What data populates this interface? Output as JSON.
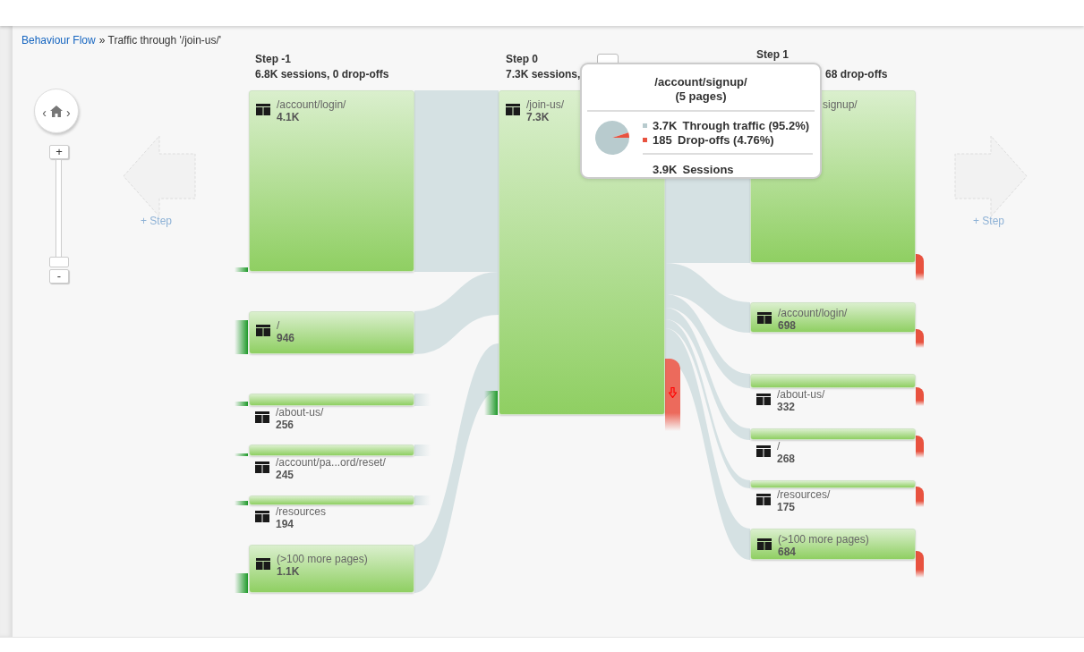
{
  "breadcrumb": {
    "link": "Behaviour Flow",
    "text": "» Traffic through '/join-us/'"
  },
  "navigator": {
    "left": "‹",
    "right": "›"
  },
  "zoom": {
    "plus": "+",
    "minus": "-",
    "level": 0
  },
  "add_step": [
    {
      "label": "+ Step"
    },
    {
      "label": "+ Step"
    }
  ],
  "steps": [
    {
      "title": "Step -1",
      "summary": "6.8K sessions, 0 drop-offs",
      "nodes": [
        {
          "label": "/account/login/",
          "value": "4.1K",
          "kind": "block"
        },
        {
          "label": "/",
          "value": "946",
          "kind": "block"
        },
        {
          "label": "/about-us/",
          "value": "256",
          "kind": "strip"
        },
        {
          "label": "/account/pa...ord/reset/",
          "value": "245",
          "kind": "strip"
        },
        {
          "label": "/resources",
          "value": "194",
          "kind": "strip"
        },
        {
          "label": "(>100 more pages)",
          "value": "1.1K",
          "kind": "block"
        }
      ]
    },
    {
      "title": "Step 0",
      "summary": "7.3K sessions,",
      "nodes": [
        {
          "label": "/join-us/",
          "value": "7.3K",
          "kind": "block"
        }
      ]
    },
    {
      "title": "Step 1",
      "summary": "68 drop-offs",
      "nodes": [
        {
          "label": "signup/",
          "kind": "covered"
        },
        {
          "label": "/account/login/",
          "value": "698",
          "kind": "block"
        },
        {
          "label": "/about-us/",
          "value": "332",
          "kind": "strip"
        },
        {
          "label": "/",
          "value": "268",
          "kind": "strip"
        },
        {
          "label": "/resources/",
          "value": "175",
          "kind": "strip"
        },
        {
          "label": "(>100 more pages)",
          "value": "684",
          "kind": "block"
        }
      ]
    }
  ],
  "tooltip": {
    "title": "/account/signup/",
    "subtitle": "(5 pages)",
    "rows": [
      {
        "color": "#b8cbce",
        "count": "3.7K",
        "label": "Through traffic (95.2%)"
      },
      {
        "color": "#e8523f",
        "count": "185",
        "label": "Drop-offs (4.76%)"
      }
    ],
    "total": {
      "value": "3.9K",
      "label": "Sessions"
    }
  }
}
